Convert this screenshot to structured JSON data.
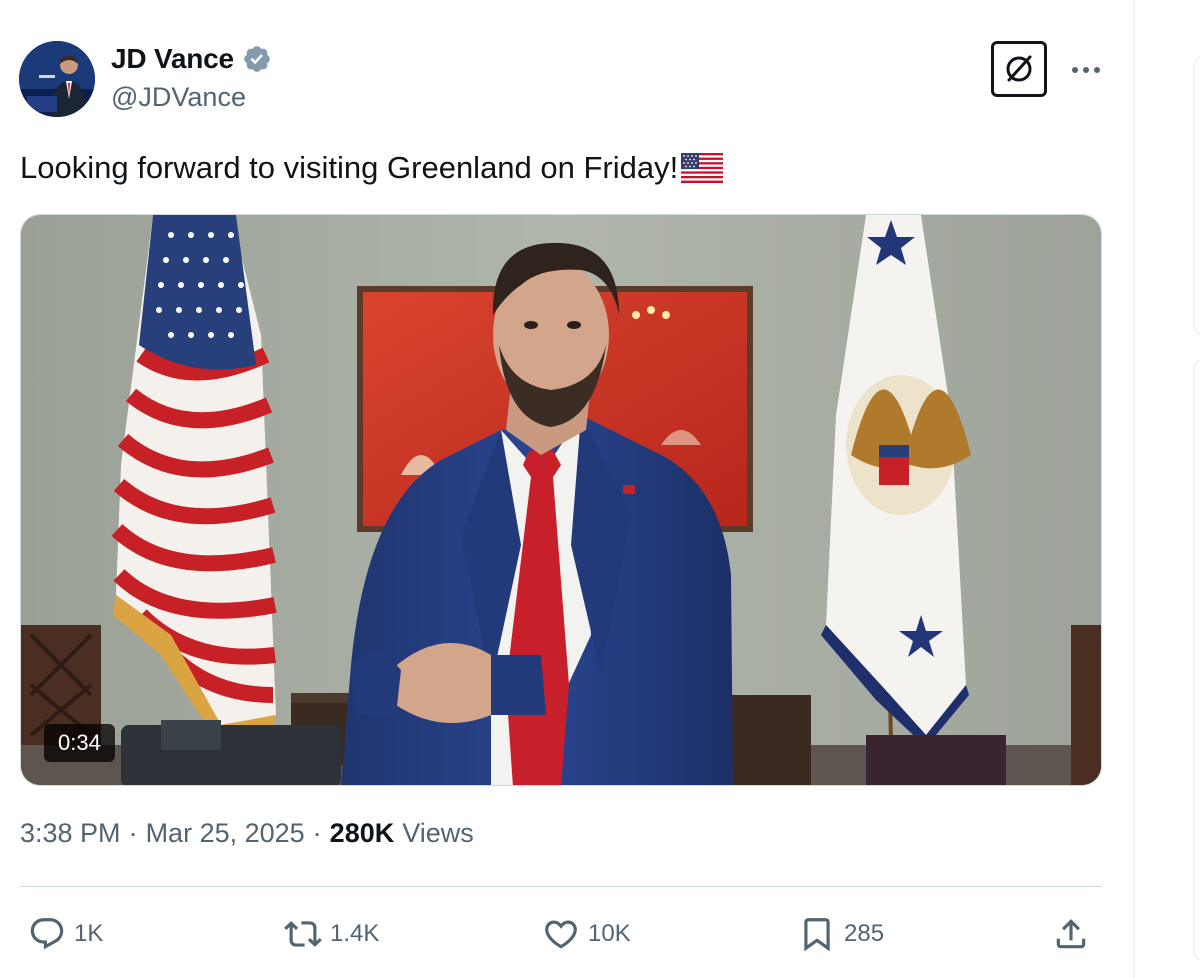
{
  "author": {
    "name": "JD Vance",
    "handle": "@JDVance",
    "verified": true
  },
  "tweet": {
    "text": "Looking forward to visiting Greenland on Friday!",
    "emoji": "flag-usa"
  },
  "media": {
    "duration": "0:34"
  },
  "meta": {
    "time": "3:38 PM",
    "separator": "·",
    "date": "Mar 25, 2025",
    "views_count": "280K",
    "views_label": "Views"
  },
  "actions": {
    "replies": "1K",
    "retweets": "1.4K",
    "likes": "10K",
    "bookmarks": "285"
  },
  "colors": {
    "text": "#0f1419",
    "secondary": "#536471",
    "verified": "#829aab",
    "border": "#cfd9de"
  }
}
